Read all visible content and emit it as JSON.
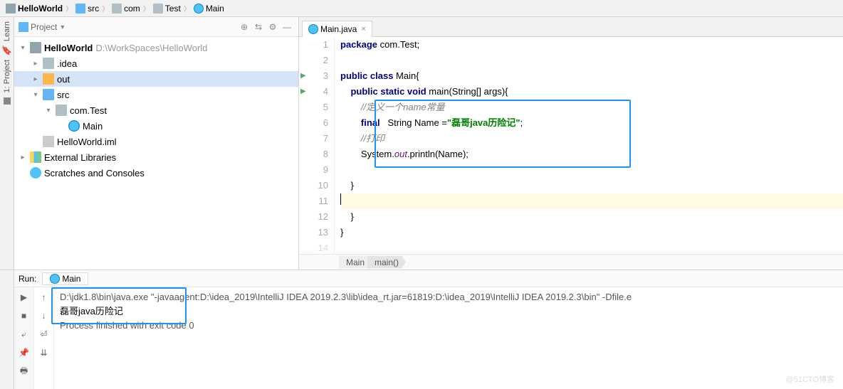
{
  "breadcrumb": {
    "items": [
      {
        "icon": "folder-dark",
        "label": "HelloWorld",
        "bold": true
      },
      {
        "icon": "folder-blue",
        "label": "src"
      },
      {
        "icon": "folder-gray",
        "label": "com"
      },
      {
        "icon": "folder-gray",
        "label": "Test"
      },
      {
        "icon": "java",
        "label": "Main"
      }
    ]
  },
  "project": {
    "title": "Project",
    "root": {
      "label": "HelloWorld",
      "path": "D:\\WorkSpaces\\HelloWorld"
    },
    "idea": ".idea",
    "out": "out",
    "src": "src",
    "pkg": "com.Test",
    "main": "Main",
    "iml": "HelloWorld.iml",
    "extlib": "External Libraries",
    "scratch": "Scratches and Consoles"
  },
  "editor": {
    "tab": "Main.java",
    "lines": {
      "l1": "package com.Test;",
      "l3a": "public class ",
      "l3b": "Main{",
      "l4a": "    public static void ",
      "l4m": "main",
      "l4b": "(String[] args){",
      "l5": "        //定义一个name常量",
      "l6a": "        final",
      "l6b": "   String Name =",
      "l6s": "\"磊哥java历险记\"",
      "l6c": ";",
      "l7": "        //打印",
      "l8a": "        System.",
      "l8o": "out",
      "l8b": ".println(Name);",
      "l10": "    }",
      "l11": "",
      "l12": "    }",
      "l13": "}"
    },
    "nav": {
      "cls": "Main",
      "m": "main()"
    }
  },
  "run": {
    "title": "Run:",
    "config": "Main",
    "cmd": "D:\\jdk1.8\\bin\\java.exe \"-javaagent:D:\\idea_2019\\IntelliJ IDEA 2019.2.3\\lib\\idea_rt.jar=61819:D:\\idea_2019\\IntelliJ IDEA 2019.2.3\\bin\" -Dfile.e",
    "out": "磊哥java历险记",
    "exit": "Process finished with exit code 0"
  },
  "watermark": "@51CTO博客"
}
